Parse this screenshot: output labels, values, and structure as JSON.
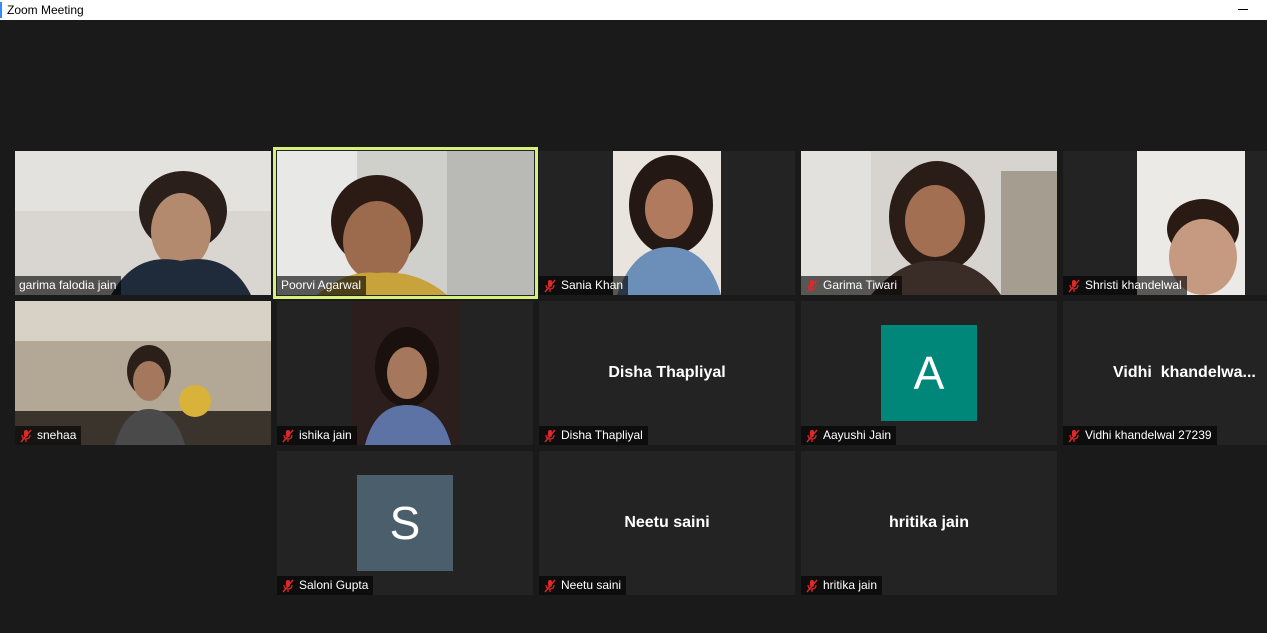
{
  "window": {
    "title": "Zoom Meeting",
    "minimize_label": "Minimize"
  },
  "colors": {
    "speaking_border": "#d7f07c",
    "avatar_A": "#00877a",
    "avatar_S": "#4a5f6b",
    "muted_icon": "#e02828"
  },
  "participants": [
    {
      "name": "garima falodia jain",
      "muted": false,
      "video": true
    },
    {
      "name": "Poorvi Agarwal",
      "muted": false,
      "video": true,
      "speaking": true
    },
    {
      "name": "Sania Khan",
      "muted": true,
      "video": true
    },
    {
      "name": "Garima Tiwari",
      "muted": true,
      "video": true
    },
    {
      "name": "Shristi khandelwal",
      "muted": true,
      "video": true
    },
    {
      "name": "snehaa",
      "muted": true,
      "video": true
    },
    {
      "name": "ishika jain",
      "muted": true,
      "video": true
    },
    {
      "name": "Disha Thapliyal",
      "display_name": "Disha Thapliyal",
      "muted": true,
      "video": false
    },
    {
      "name": "Aayushi Jain",
      "avatar_letter": "A",
      "muted": true,
      "video": false
    },
    {
      "name": "Vidhi khandelwal 27239",
      "display_name": "Vidhi  khandelwa...",
      "muted": true,
      "video": false
    },
    {
      "name": "Saloni Gupta",
      "avatar_letter": "S",
      "muted": true,
      "video": false
    },
    {
      "name": "Neetu saini",
      "display_name": "Neetu saini",
      "muted": true,
      "video": false
    },
    {
      "name": "hritika jain",
      "display_name": "hritika jain",
      "muted": true,
      "video": false
    }
  ]
}
